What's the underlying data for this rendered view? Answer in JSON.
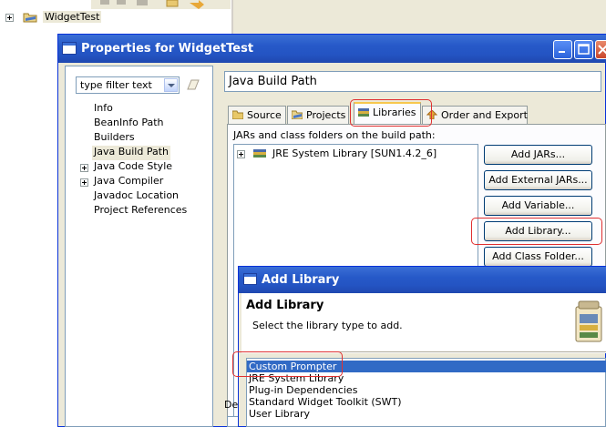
{
  "background": {
    "tree_item": "WidgetTest"
  },
  "properties_dialog": {
    "title": "Properties for WidgetTest",
    "filter_placeholder": "type filter text",
    "nav_items": [
      {
        "label": "Info",
        "expandable": false
      },
      {
        "label": "BeanInfo Path",
        "expandable": false
      },
      {
        "label": "Builders",
        "expandable": false
      },
      {
        "label": "Java Build Path",
        "expandable": false,
        "selected": true
      },
      {
        "label": "Java Code Style",
        "expandable": true
      },
      {
        "label": "Java Compiler",
        "expandable": true
      },
      {
        "label": "Javadoc Location",
        "expandable": false
      },
      {
        "label": "Project References",
        "expandable": false
      }
    ],
    "page_title": "Java Build Path",
    "tabs": [
      "Source",
      "Projects",
      "Libraries",
      "Order and Export"
    ],
    "active_tab": "Libraries",
    "jars_label": "JARs and class folders on the build path:",
    "libraries": [
      "JRE System Library [SUN1.4.2_6]"
    ],
    "buttons": [
      "Add JARs...",
      "Add External JARs...",
      "Add Variable...",
      "Add Library...",
      "Add Class Folder..."
    ],
    "default_output_label": "Def"
  },
  "add_library_dialog": {
    "title": "Add Library",
    "heading": "Add Library",
    "description": "Select the library type to add.",
    "library_types": [
      "Custom Prompter",
      "JRE System Library",
      "Plug-in Dependencies",
      "Standard Widget Toolkit (SWT)",
      "User Library"
    ],
    "selected": "Custom Prompter"
  },
  "colors": {
    "titlebar": "#2659c8",
    "selection": "#316ac5",
    "highlight_annotation": "#e03030"
  }
}
